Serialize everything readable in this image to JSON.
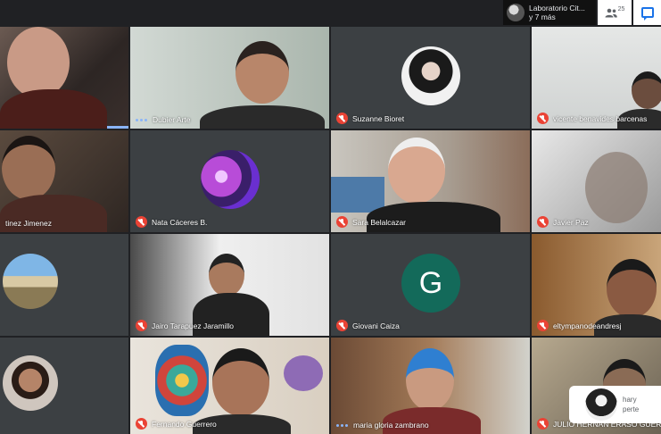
{
  "topbar": {
    "presenter_line1": "Laboratorio Cit...",
    "presenter_line2": "y 7 más",
    "people_count": "25",
    "people_icon": "people-icon",
    "chat_icon": "chat-icon"
  },
  "colors": {
    "background": "#202124",
    "tile": "#3c4043",
    "mic_off": "#ea4335",
    "speaking": "#8ab4f8",
    "letter_avatar": "#136a5a"
  },
  "participants": [
    {
      "name": "",
      "muted": false
    },
    {
      "name": "Dubier Arte",
      "muted": false,
      "speaking": true
    },
    {
      "name": "Suzanne Bioret",
      "muted": true
    },
    {
      "name": "vicente benavides barcenas",
      "muted": true
    },
    {
      "name": "tinez Jimenez",
      "muted": false
    },
    {
      "name": "Nata Cáceres B.",
      "muted": true
    },
    {
      "name": "Sara Belalcazar",
      "muted": true
    },
    {
      "name": "Javier Paz",
      "muted": true
    },
    {
      "name": "",
      "muted": false
    },
    {
      "name": "Jairo Tarapuez Jaramillo",
      "muted": true
    },
    {
      "name": "Giovani Caiza",
      "muted": true,
      "avatar_letter": "G"
    },
    {
      "name": "eltympanodeandresj",
      "muted": true
    },
    {
      "name": "",
      "muted": false
    },
    {
      "name": "Fernando Guerrero",
      "muted": true
    },
    {
      "name": "maria gloria zambrano",
      "muted": false,
      "speaking": true
    },
    {
      "name": "JULIO HERNAN ERASO GUERRERO",
      "muted": true
    }
  ],
  "snackbar": {
    "line1": "hary",
    "line2": "perte"
  }
}
